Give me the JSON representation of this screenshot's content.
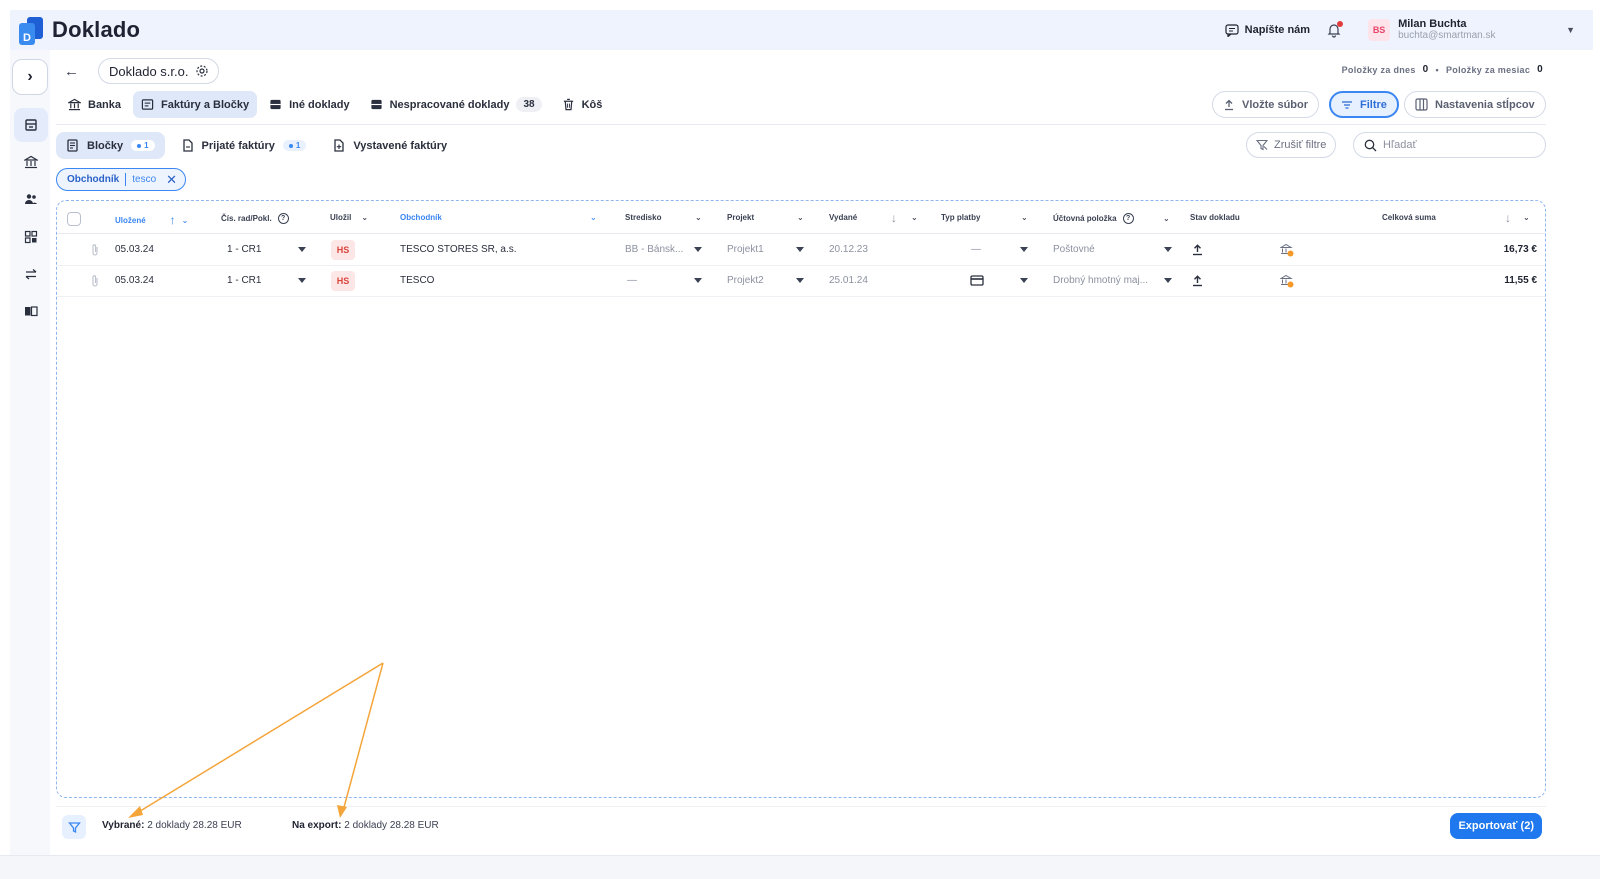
{
  "app": {
    "name": "Doklado",
    "write_us": "Napíšte nám",
    "user": {
      "initials": "BS",
      "name": "Milan Buchta",
      "email": "buchta@smartman.sk"
    }
  },
  "company": {
    "name": "Doklado s.r.o.",
    "items_today_label": "Položky za dnes",
    "items_today": "0",
    "items_month_label": "Položky za mesiac",
    "items_month": "0"
  },
  "tabs": [
    {
      "label": "Banka",
      "icon": "bank-icon"
    },
    {
      "label": "Faktúry a Bločky",
      "icon": "invoice-icon",
      "active": true
    },
    {
      "label": "Iné doklady",
      "icon": "tray-icon"
    },
    {
      "label": "Nespracované doklady",
      "icon": "tray-icon",
      "count": "38"
    },
    {
      "label": "Kôš",
      "icon": "trash-icon"
    }
  ],
  "toolbar": {
    "upload": "Vložte súbor",
    "filters": "Filtre",
    "columns": "Nastavenia stĺpcov"
  },
  "subtabs": [
    {
      "label": "Bločky",
      "badge": "1",
      "active": true
    },
    {
      "label": "Prijaté faktúry",
      "badge": "1"
    },
    {
      "label": "Vystavené faktúry"
    }
  ],
  "clear_filters": "Zrušiť filtre",
  "search": {
    "placeholder": "Hľadať"
  },
  "chip": {
    "key": "Obchodník",
    "value": "tesco"
  },
  "table": {
    "columns": {
      "saved": "Uložené",
      "series": "Čís. rad/Pokl.",
      "saved_by": "Uložil",
      "merchant": "Obchodník",
      "center": "Stredisko",
      "project": "Projekt",
      "issued": "Vydané",
      "payment_type": "Typ platby",
      "account_item": "Účtovná položka",
      "doc_state": "Stav dokladu",
      "total": "Celková suma"
    },
    "rows": [
      {
        "saved": "05.03.24",
        "series": "1 - CR1",
        "saved_by": "HS",
        "merchant": "TESCO STORES SR, a.s.",
        "center": "BB - Bánsk...",
        "project": "Projekt1",
        "issued": "20.12.23",
        "payment_type": "—",
        "account_item": "Poštovné",
        "total": "16,73 €"
      },
      {
        "saved": "05.03.24",
        "series": "1 - CR1",
        "saved_by": "HS",
        "merchant": "TESCO",
        "center": "—",
        "project": "Projekt2",
        "issued": "25.01.24",
        "payment_type": "card",
        "account_item": "Drobný hmotný maj...",
        "total": "11,55 €"
      }
    ]
  },
  "footer": {
    "selected_label": "Vybrané:",
    "selected_value": "2 doklady 28.28 EUR",
    "export_label": "Na export:",
    "export_value": "2 doklady 28.28 EUR",
    "export_button": "Exportovať (2)"
  },
  "colors": {
    "accent": "#3a86f2",
    "header_bg": "#eef3fd",
    "annotation": "#f4a53a"
  }
}
